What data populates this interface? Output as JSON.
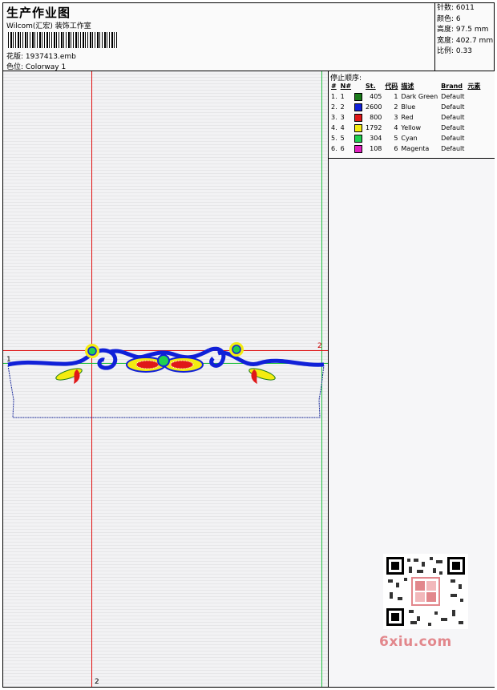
{
  "header": {
    "title": "生产作业图",
    "company": "Wilcom(汇宏) 装饰工作室",
    "design_label": "花版:",
    "design_value": "1937413.emb",
    "colorway_label": "色位:",
    "colorway_value": "Colorway 1"
  },
  "stats": [
    {
      "label": "针数",
      "value": "6011"
    },
    {
      "label": "颜色",
      "value": "6"
    },
    {
      "label": "高度",
      "value": "97.5 mm"
    },
    {
      "label": "宽度",
      "value": "402.7 mm"
    },
    {
      "label": "比例",
      "value": "0.33"
    }
  ],
  "color_table": {
    "title": "停止顺序:",
    "headers": [
      "#",
      "N#",
      "St.",
      "代码",
      "描述",
      "Brand",
      "元素"
    ],
    "rows": [
      {
        "idx": "1.",
        "n": "1",
        "color": "#1a7a1a",
        "st": "405",
        "code": "1",
        "desc": "Dark Green",
        "brand": "Default"
      },
      {
        "idx": "2.",
        "n": "2",
        "color": "#1020d8",
        "st": "2600",
        "code": "2",
        "desc": "Blue",
        "brand": "Default"
      },
      {
        "idx": "3.",
        "n": "3",
        "color": "#e01818",
        "st": "800",
        "code": "3",
        "desc": "Red",
        "brand": "Default"
      },
      {
        "idx": "4.",
        "n": "4",
        "color": "#f4ec10",
        "st": "1792",
        "code": "4",
        "desc": "Yellow",
        "brand": "Default"
      },
      {
        "idx": "5.",
        "n": "5",
        "color": "#20d050",
        "st": "304",
        "code": "5",
        "desc": "Cyan",
        "brand": "Default"
      },
      {
        "idx": "6.",
        "n": "6",
        "color": "#e020c0",
        "st": "108",
        "code": "6",
        "desc": "Magenta",
        "brand": "Default"
      }
    ]
  },
  "markers": {
    "top_right": "2",
    "bottom": "2",
    "left": "1"
  },
  "watermark": "6xiu.com",
  "colors": {
    "guide_red": "#e01010",
    "guide_green": "#20c040",
    "outline_blue": "#1a2a9a"
  }
}
